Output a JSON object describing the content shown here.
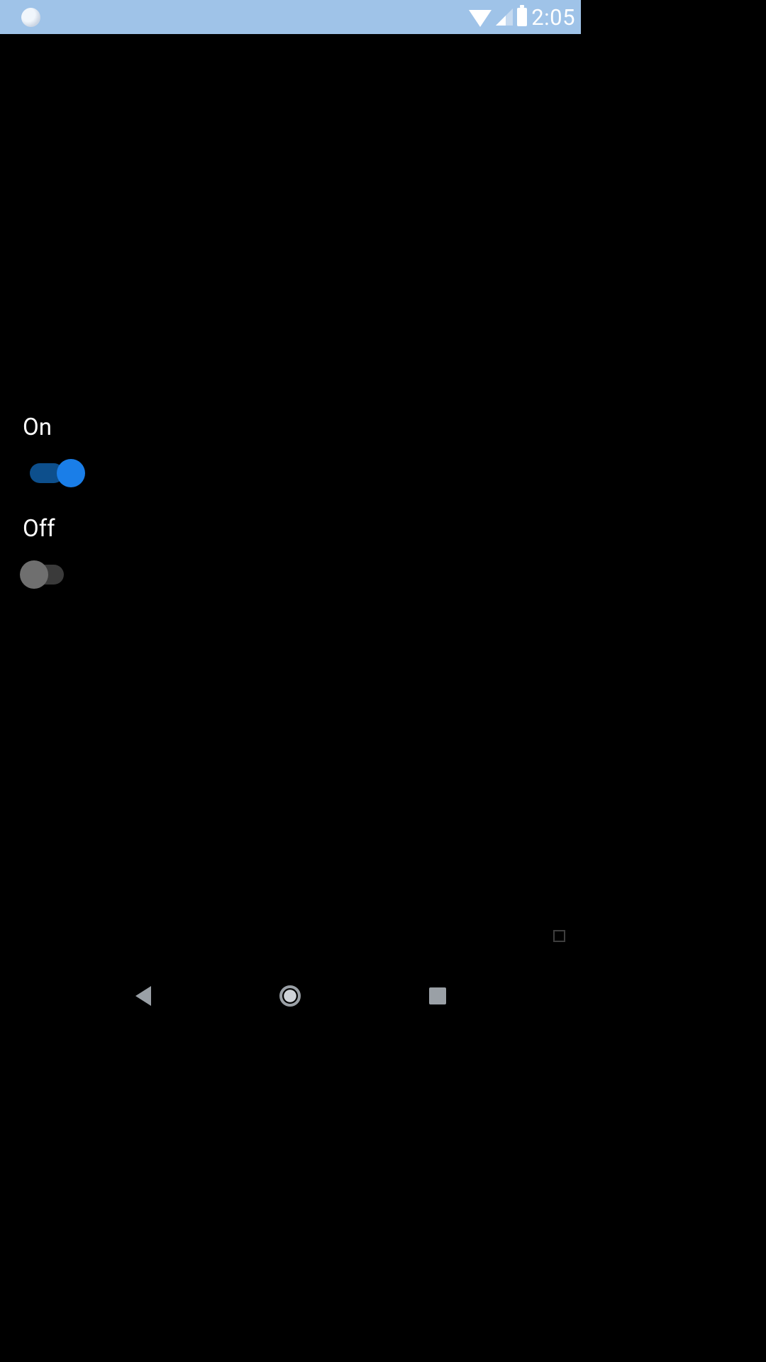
{
  "status_bar": {
    "clock": "2:05"
  },
  "toggles": {
    "on": {
      "label": "On",
      "state": "on"
    },
    "off": {
      "label": "Off",
      "state": "off"
    }
  },
  "colors": {
    "status_bar_bg": "#9fc3e8",
    "switch_on_thumb": "#1a7ee8",
    "switch_on_track": "#0d4f8c",
    "switch_off_thumb": "#6f6f6f",
    "switch_off_track": "#3a3a3a"
  }
}
